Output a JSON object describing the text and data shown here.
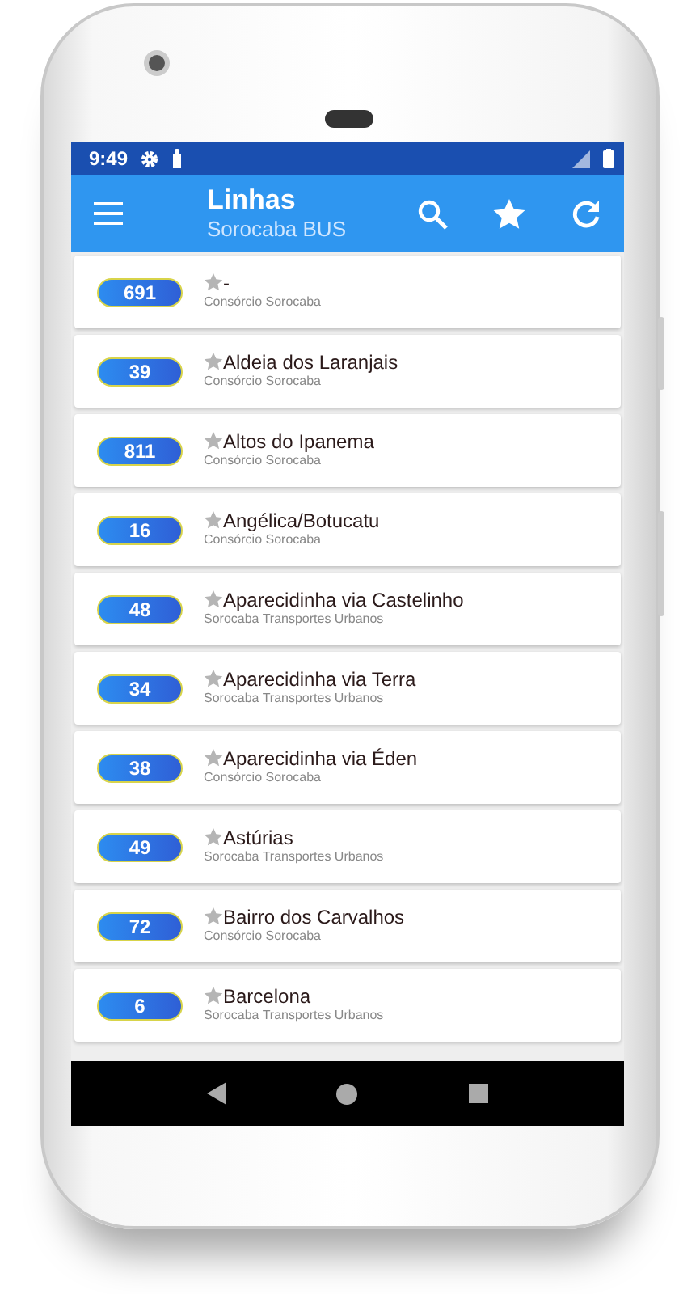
{
  "status_bar": {
    "time": "9:49"
  },
  "app_bar": {
    "title": "Linhas",
    "subtitle": "Sorocaba BUS"
  },
  "lines": [
    {
      "number": "691",
      "name": "-",
      "operator": "Consórcio Sorocaba",
      "favorite": false
    },
    {
      "number": "39",
      "name": "Aldeia dos Laranjais",
      "operator": "Consórcio Sorocaba",
      "favorite": false
    },
    {
      "number": "811",
      "name": "Altos do Ipanema",
      "operator": "Consórcio Sorocaba",
      "favorite": false
    },
    {
      "number": "16",
      "name": "Angélica/Botucatu",
      "operator": "Consórcio Sorocaba",
      "favorite": false
    },
    {
      "number": "48",
      "name": "Aparecidinha via Castelinho",
      "operator": "Sorocaba Transportes Urbanos",
      "favorite": false
    },
    {
      "number": "34",
      "name": "Aparecidinha via Terra",
      "operator": "Sorocaba Transportes Urbanos",
      "favorite": false
    },
    {
      "number": "38",
      "name": "Aparecidinha via Éden",
      "operator": "Consórcio Sorocaba",
      "favorite": false
    },
    {
      "number": "49",
      "name": "Astúrias",
      "operator": "Sorocaba Transportes Urbanos",
      "favorite": false
    },
    {
      "number": "72",
      "name": "Bairro dos Carvalhos",
      "operator": "Consórcio Sorocaba",
      "favorite": false
    },
    {
      "number": "6",
      "name": "Barcelona",
      "operator": "Sorocaba Transportes Urbanos",
      "favorite": false
    }
  ]
}
